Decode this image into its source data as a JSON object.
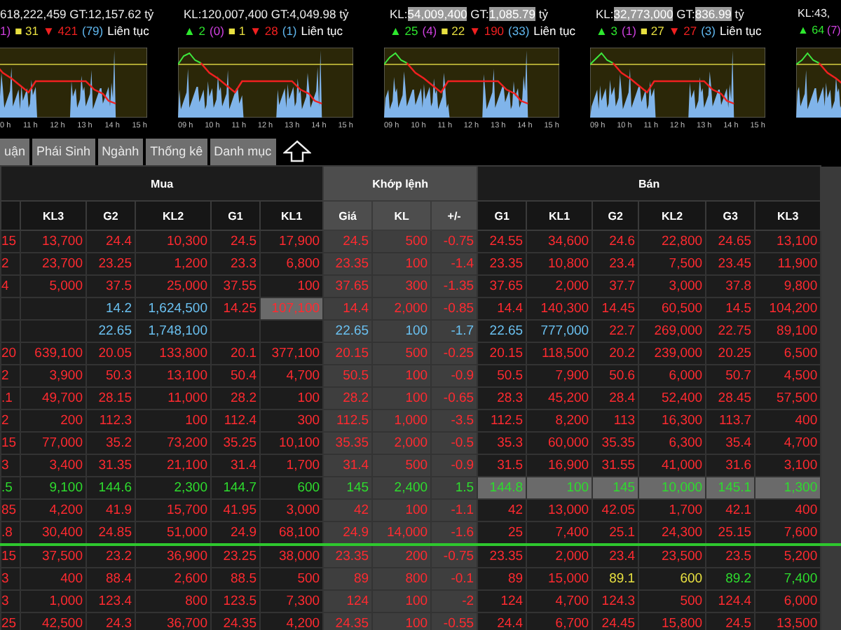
{
  "index_panels": [
    {
      "kl": "618,222,459",
      "gt_label": "GT:",
      "gt": "12,157.62",
      "unit": "tỷ",
      "volume_highlighted": false,
      "stats": [
        {
          "kind": "ceiling",
          "text": "1)"
        },
        {
          "kind": "ref",
          "text": "■ 31"
        },
        {
          "kind": "down",
          "text": "▼ 421"
        },
        {
          "kind": "floor",
          "text": "(79)"
        },
        {
          "kind": "session",
          "text": "Liên tục"
        }
      ],
      "time_labels": [
        "0 h",
        "11 h",
        "12 h",
        "13 h",
        "14 h",
        "15 h"
      ]
    },
    {
      "kl_label": "KL:",
      "kl": "120,007,400",
      "gt_label": "GT:",
      "gt": "4,049.98",
      "unit": "tỷ",
      "volume_highlighted": false,
      "stats": [
        {
          "kind": "up",
          "text": "▲ 2"
        },
        {
          "kind": "ceiling",
          "text": "(0)"
        },
        {
          "kind": "ref",
          "text": "■ 1"
        },
        {
          "kind": "down",
          "text": "▼ 28"
        },
        {
          "kind": "floor",
          "text": "(1)"
        },
        {
          "kind": "session",
          "text": "Liên tục"
        }
      ],
      "time_labels": [
        "09 h",
        "10 h",
        "11 h",
        "12 h",
        "13 h",
        "14 h",
        "15 h"
      ]
    },
    {
      "kl_label": "KL:",
      "kl": "54,009,400",
      "gt_label": "GT:",
      "gt": "1,085.79",
      "unit": "tỷ",
      "volume_highlighted": true,
      "stats": [
        {
          "kind": "up",
          "text": "▲ 25"
        },
        {
          "kind": "ceiling",
          "text": "(4)"
        },
        {
          "kind": "ref",
          "text": "■ 22"
        },
        {
          "kind": "down",
          "text": "▼ 190"
        },
        {
          "kind": "floor",
          "text": "(33)"
        },
        {
          "kind": "session",
          "text": "Liên tục"
        }
      ],
      "time_labels": [
        "09 h",
        "10 h",
        "11 h",
        "12 h",
        "13 h",
        "14 h",
        "15 h"
      ]
    },
    {
      "kl_label": "KL:",
      "kl": "32,773,000",
      "gt_label": "GT:",
      "gt": "836.99",
      "unit": "tỷ",
      "volume_highlighted": true,
      "stats": [
        {
          "kind": "up",
          "text": "▲ 3"
        },
        {
          "kind": "ceiling",
          "text": "(1)"
        },
        {
          "kind": "ref",
          "text": "■ 27"
        },
        {
          "kind": "down",
          "text": "▼ 27"
        },
        {
          "kind": "floor",
          "text": "(3)"
        },
        {
          "kind": "session",
          "text": "Liên tục"
        }
      ],
      "time_labels": [
        "09 h",
        "10 h",
        "11 h",
        "12 h",
        "13 h",
        "14 h",
        "15 h"
      ]
    },
    {
      "kl_label": "KL:",
      "kl": "43,",
      "volume_highlighted": false,
      "stats": [
        {
          "kind": "up",
          "text": "▲ 64"
        },
        {
          "kind": "ceiling",
          "text": "(7)"
        }
      ]
    }
  ],
  "tabs": [
    {
      "label": "uận"
    },
    {
      "label": "Phái Sinh"
    },
    {
      "label": "Ngành"
    },
    {
      "label": "Thống kê"
    },
    {
      "label": "Danh mục"
    }
  ],
  "table": {
    "column_groups": [
      "Mua",
      "Khớp lệnh",
      "Bán"
    ],
    "columns": [
      null,
      "KL3",
      "G2",
      "KL2",
      "G1",
      "KL1",
      "Giá",
      "KL",
      "+/-",
      "G1",
      "KL1",
      "G2",
      "KL2",
      "G3",
      "KL3"
    ],
    "rows": [
      {
        "color": "#ff2a30",
        "divider": false,
        "cells": [
          "15",
          "13,700",
          "24.4",
          "10,300",
          "24.5",
          "17,900",
          "24.5",
          "500",
          "-0.75",
          "24.55",
          "34,600",
          "24.6",
          "22,800",
          "24.65",
          "13,100"
        ]
      },
      {
        "color": "#ff2a30",
        "divider": false,
        "cells": [
          "2",
          "23,700",
          "23.25",
          "1,200",
          "23.3",
          "6,800",
          "23.35",
          "100",
          "-1.4",
          "23.35",
          "10,800",
          "23.4",
          "7,500",
          "23.45",
          "11,900"
        ]
      },
      {
        "color": "#ff2a30",
        "divider": false,
        "cells": [
          "4",
          "5,000",
          "37.5",
          "25,000",
          "37.55",
          "100",
          "37.65",
          "300",
          "-1.35",
          "37.65",
          "2,000",
          "37.7",
          "3,000",
          "37.8",
          "9,800"
        ]
      },
      {
        "color": "#ff2a30",
        "divider": false,
        "cells": [
          null,
          null,
          {
            "text": "14.2",
            "color": "#6ac0f0"
          },
          {
            "text": "1,624,500",
            "color": "#6ac0f0"
          },
          "14.25",
          {
            "text": "107,100",
            "highlighted": true
          },
          "14.4",
          "2,000",
          "-0.85",
          "14.4",
          "140,300",
          "14.45",
          "60,500",
          "14.5",
          "104,200"
        ]
      },
      {
        "color": "#6ac0f0",
        "divider": false,
        "cells": [
          null,
          null,
          "22.65",
          "1,748,100",
          null,
          null,
          "22.65",
          "100",
          "-1.7",
          "22.65",
          "777,000",
          {
            "text": "22.7",
            "color": "#ff2a30"
          },
          {
            "text": "269,000",
            "color": "#ff2a30"
          },
          {
            "text": "22.75",
            "color": "#ff2a30"
          },
          {
            "text": "89,100",
            "color": "#ff2a30"
          }
        ]
      },
      {
        "color": "#ff2a30",
        "divider": false,
        "cells": [
          "20",
          "639,100",
          "20.05",
          "133,800",
          "20.1",
          "377,100",
          "20.15",
          "500",
          "-0.25",
          "20.15",
          "118,500",
          "20.2",
          "239,000",
          "20.25",
          "6,500"
        ]
      },
      {
        "color": "#ff2a30",
        "divider": false,
        "cells": [
          "2",
          "3,900",
          "50.3",
          "13,100",
          "50.4",
          "4,700",
          "50.5",
          "100",
          "-0.9",
          "50.5",
          "7,900",
          "50.6",
          "6,000",
          "50.7",
          "4,500"
        ]
      },
      {
        "color": "#ff2a30",
        "divider": false,
        "cells": [
          ".1",
          "49,700",
          "28.15",
          "11,000",
          "28.2",
          "100",
          "28.2",
          "100",
          "-0.65",
          "28.3",
          "45,200",
          "28.4",
          "52,400",
          "28.45",
          "57,500"
        ]
      },
      {
        "color": "#ff2a30",
        "divider": false,
        "cells": [
          "2",
          "200",
          "112.3",
          "100",
          "112.4",
          "300",
          "112.5",
          "1,000",
          "-3.5",
          "112.5",
          "8,200",
          "113",
          "16,300",
          "113.7",
          "400"
        ]
      },
      {
        "color": "#ff2a30",
        "divider": false,
        "cells": [
          "15",
          "77,000",
          "35.2",
          "73,200",
          "35.25",
          "10,100",
          "35.35",
          "2,000",
          "-0.5",
          "35.3",
          "60,000",
          "35.35",
          "6,300",
          "35.4",
          "4,700"
        ]
      },
      {
        "color": "#ff2a30",
        "divider": false,
        "cells": [
          "3",
          "3,400",
          "31.35",
          "21,100",
          "31.4",
          "1,700",
          "31.4",
          "500",
          "-0.9",
          "31.5",
          "16,900",
          "31.55",
          "41,000",
          "31.6",
          "3,100"
        ]
      },
      {
        "color": "#2edc2e",
        "divider": false,
        "cells": [
          ".5",
          "9,100",
          "144.6",
          "2,300",
          "144.7",
          "600",
          "145",
          "2,400",
          "1.5",
          {
            "text": "144.8",
            "highlighted": true
          },
          {
            "text": "100",
            "highlighted": true
          },
          {
            "text": "145",
            "highlighted": true
          },
          {
            "text": "10,000",
            "highlighted": true
          },
          {
            "text": "145.1",
            "highlighted": true
          },
          {
            "text": "1,300",
            "highlighted": true
          }
        ]
      },
      {
        "color": "#ff2a30",
        "divider": false,
        "cells": [
          "85",
          "4,200",
          "41.9",
          "15,700",
          "41.95",
          "3,000",
          "42",
          "100",
          "-1.1",
          "42",
          "13,000",
          "42.05",
          "1,700",
          "42.1",
          "400"
        ]
      },
      {
        "color": "#ff2a30",
        "divider": false,
        "cells": [
          ".8",
          "30,400",
          "24.85",
          "51,000",
          "24.9",
          "68,100",
          "24.9",
          "14,000",
          "-1.6",
          "25",
          "7,400",
          "25.1",
          "24,300",
          "25.15",
          "7,600"
        ]
      },
      {
        "color": "#ff2a30",
        "divider": true,
        "cells": [
          "15",
          "37,500",
          "23.2",
          "36,900",
          "23.25",
          "38,000",
          "23.35",
          "200",
          "-0.75",
          "23.35",
          "2,000",
          "23.4",
          "23,500",
          "23.5",
          "5,200"
        ]
      },
      {
        "color": "#ff2a30",
        "divider": false,
        "cells": [
          "3",
          "400",
          "88.4",
          "2,600",
          "88.5",
          "500",
          "89",
          "800",
          "-0.1",
          "89",
          "15,000",
          {
            "text": "89.1",
            "color": "#e8e040"
          },
          {
            "text": "600",
            "color": "#e8e040"
          },
          {
            "text": "89.2",
            "color": "#2edc2e"
          },
          {
            "text": "7,400",
            "color": "#2edc2e"
          }
        ]
      },
      {
        "color": "#ff2a30",
        "divider": false,
        "cells": [
          "3",
          "1,000",
          "123.4",
          "800",
          "123.5",
          "7,300",
          "124",
          "100",
          "-2",
          "124",
          "4,700",
          "124.3",
          "500",
          "124.4",
          "6,000"
        ]
      },
      {
        "color": "#ff2a30",
        "divider": false,
        "cells": [
          "25",
          "42,500",
          "24.3",
          "36,700",
          "24.35",
          "4,200",
          "24.35",
          "100",
          "-0.55",
          "24.4",
          "6,700",
          "24.45",
          "15,800",
          "24.5",
          "13,500"
        ]
      }
    ]
  }
}
